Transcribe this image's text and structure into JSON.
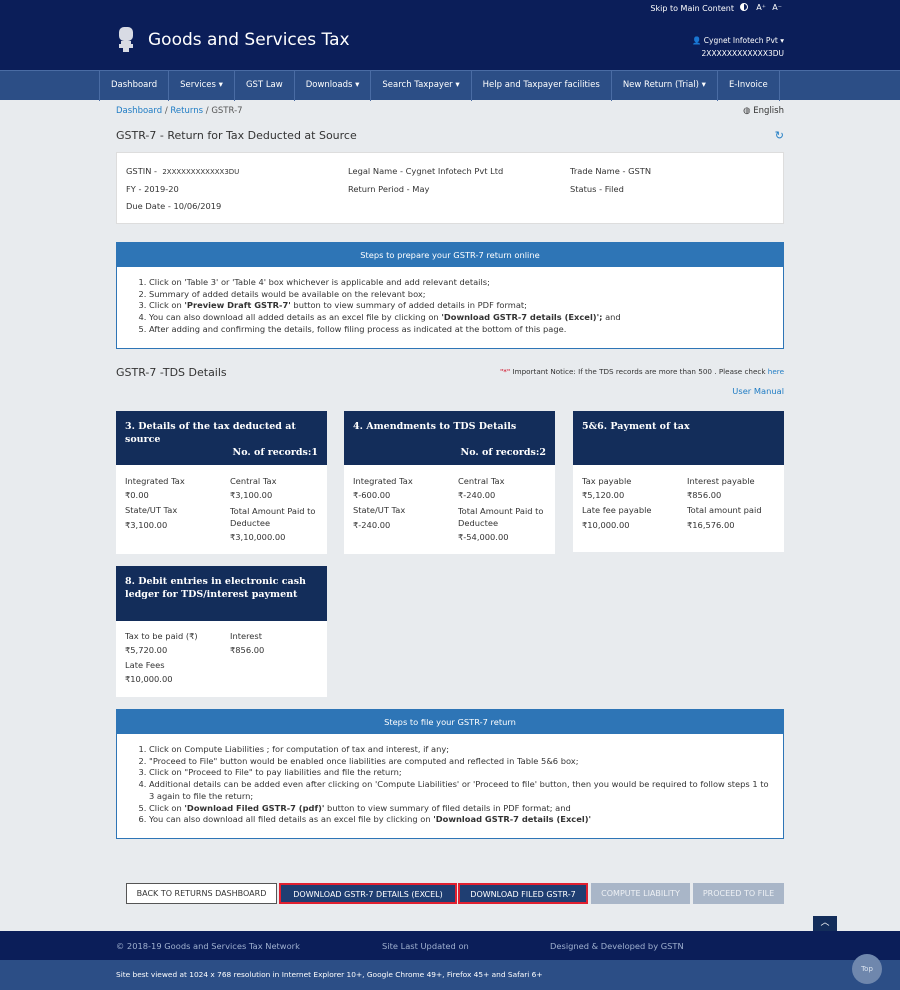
{
  "topbar": {
    "skip": "Skip to Main Content",
    "a_plus": "A⁺",
    "a_minus": "A⁻"
  },
  "header": {
    "title": "Goods and Services Tax",
    "user_name": "Cygnet Infotech Pvt",
    "gstin": "2XXXXXXXXXXXX3DU"
  },
  "nav": [
    "Dashboard",
    "Services ▾",
    "GST Law",
    "Downloads ▾",
    "Search Taxpayer ▾",
    "Help and Taxpayer facilities",
    "New Return (Trial) ▾",
    "E-Invoice"
  ],
  "breadcrumb": {
    "b1": "Dashboard",
    "b2": "Returns",
    "b3": "GSTR-7",
    "sep": "/"
  },
  "language": "English",
  "page_title": "GSTR-7 - Return for Tax Deducted at Source",
  "info": {
    "gstin_label": "GSTIN -",
    "gstin": "2XXXXXXXXXXXX3DU",
    "legal": "Legal Name - Cygnet Infotech Pvt Ltd",
    "trade": "Trade Name - GSTN",
    "fy": "FY - 2019-20",
    "period": "Return Period - May",
    "status": "Status - Filed",
    "due": "Due Date - 10/06/2019"
  },
  "steps_prepare": {
    "header": "Steps to prepare your GSTR-7 return online",
    "s1": "Click on 'Table 3' or 'Table 4' box whichever is applicable and add relevant details;",
    "s2": "Summary of added details would be available on the relevant box;",
    "s3a": "Click on ",
    "s3b": "'Preview Draft GSTR-7'",
    "s3c": " button to view summary of added details in PDF format;",
    "s4a": "You can also download all added details as an excel file by clicking on ",
    "s4b": "'Download GSTR-7 details (Excel)';",
    "s4c": " and",
    "s5": "After adding and confirming the details, follow filing process as indicated at the bottom of this page."
  },
  "tds": {
    "title": "GSTR-7 -TDS Details",
    "notice_star": "\"*\"",
    "notice": " Important Notice: If the TDS records are more than 500 . Please check ",
    "notice_link": "here",
    "manual": "User Manual"
  },
  "tile3": {
    "title": "3. Details of the tax deducted at source",
    "records": "No. of records:1",
    "l1": "Integrated Tax",
    "v1": "₹0.00",
    "l2": "Central Tax",
    "v2": "₹3,100.00",
    "l3": "State/UT Tax",
    "v3": "₹3,100.00",
    "l4": "Total Amount Paid to Deductee",
    "v4": "₹3,10,000.00"
  },
  "tile4": {
    "title": "4. Amendments to TDS Details",
    "records": "No. of records:2",
    "l1": "Integrated Tax",
    "v1": "₹-600.00",
    "l2": "Central Tax",
    "v2": "₹-240.00",
    "l3": "State/UT Tax",
    "v3": "₹-240.00",
    "l4": "Total Amount Paid to Deductee",
    "v4": "₹-54,000.00"
  },
  "tile56": {
    "title": "5&6. Payment of tax",
    "l1": "Tax payable",
    "v1": "₹5,120.00",
    "l2": "Interest payable",
    "v2": "₹856.00",
    "l3": "Late fee payable",
    "v3": "₹10,000.00",
    "l4": "Total amount paid",
    "v4": "₹16,576.00"
  },
  "tile8": {
    "title": "8. Debit entries in electronic cash ledger for TDS/interest payment",
    "l1": "Tax to be paid (₹)",
    "v1": "₹5,720.00",
    "l2": "Interest",
    "v2": "₹856.00",
    "l3": "Late Fees",
    "v3": "₹10,000.00"
  },
  "steps_file": {
    "header": "Steps to file your GSTR-7 return",
    "s1": "Click on Compute Liabilities ; for computation of tax and interest, if any;",
    "s2": "\"Proceed to File\" button would be enabled once liabilities are computed and reflected in Table 5&6 box;",
    "s3": "Click on \"Proceed to File\" to pay liabilities and file the return;",
    "s4": "Additional details can be added even after clicking on 'Compute Liabilities' or 'Proceed to file' button, then you would be required to follow steps 1 to 3 again to file the return;",
    "s5a": "Click on ",
    "s5b": "'Download Filed GSTR-7 (pdf)'",
    "s5c": " button to view summary of filed details in PDF format; and",
    "s6a": "You can also download all filed details as an excel file by clicking on ",
    "s6b": "'Download GSTR-7 details (Excel)'"
  },
  "buttons": {
    "back": "BACK TO RETURNS DASHBOARD",
    "excel": "DOWNLOAD GSTR-7 DETAILS (EXCEL)",
    "filed": "DOWNLOAD FILED GSTR-7",
    "compute": "COMPUTE LIABILITY",
    "proceed": "PROCEED TO FILE"
  },
  "footer": {
    "copyright": "© 2018-19 Goods and Services Tax Network",
    "updated": "Site Last Updated on",
    "designed": "Designed & Developed by GSTN",
    "best": "Site best viewed at 1024 x 768 resolution in Internet Explorer 10+, Google Chrome 49+, Firefox 45+ and Safari 6+",
    "top": "Top"
  }
}
